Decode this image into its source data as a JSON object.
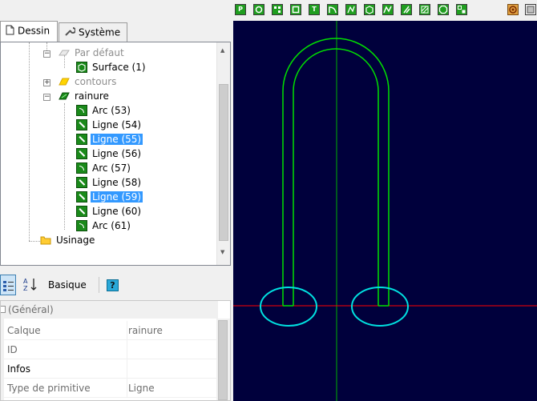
{
  "tabs": [
    {
      "label": "Dessin",
      "icon": "document-icon"
    },
    {
      "label": "Système",
      "icon": "wrench-icon"
    }
  ],
  "tree": {
    "nodes": [
      {
        "label": "Par défaut",
        "icon": "layer-icon"
      },
      {
        "label": "Surface (1)",
        "icon": "surface-icon"
      },
      {
        "label": "contours",
        "icon": "layer-icon"
      },
      {
        "label": "rainure",
        "icon": "layer-icon"
      },
      {
        "label": "Arc (53)",
        "icon": "arc-icon"
      },
      {
        "label": "Ligne (54)",
        "icon": "line-icon"
      },
      {
        "label": "Ligne (55)",
        "icon": "line-icon",
        "selected": true
      },
      {
        "label": "Ligne (56)",
        "icon": "line-icon"
      },
      {
        "label": "Arc (57)",
        "icon": "arc-icon"
      },
      {
        "label": "Ligne (58)",
        "icon": "line-icon"
      },
      {
        "label": "Ligne (59)",
        "icon": "line-icon",
        "selected": true
      },
      {
        "label": "Ligne (60)",
        "icon": "line-icon"
      },
      {
        "label": "Arc (61)",
        "icon": "arc-icon"
      },
      {
        "label": "Usinage",
        "icon": "folder-icon"
      }
    ]
  },
  "properties_toolbar": {
    "categorized_icon": "categorized-icon",
    "sort_icon": "sort-az-icon",
    "basic_label": "Basique",
    "help_icon": "help-icon",
    "help_glyph": "?"
  },
  "properties": {
    "category": "(Général)",
    "rows": [
      {
        "name": "Calque",
        "value": "rainure"
      },
      {
        "name": "ID",
        "value": ""
      },
      {
        "name": "Infos",
        "value": ""
      },
      {
        "name": "Type de primitive",
        "value": "Ligne"
      }
    ]
  },
  "toolbar": {
    "letters": [
      "P",
      "",
      "",
      "",
      "T",
      "",
      "",
      "",
      "",
      "",
      "",
      "",
      "",
      ""
    ]
  },
  "colors": {
    "canvas_bg": "#00003c",
    "shape_green": "#00e000",
    "axis_red": "#ff0000",
    "axis_green": "#00b000",
    "circle_cyan": "#00e0e0",
    "selection": "#3399ff"
  }
}
